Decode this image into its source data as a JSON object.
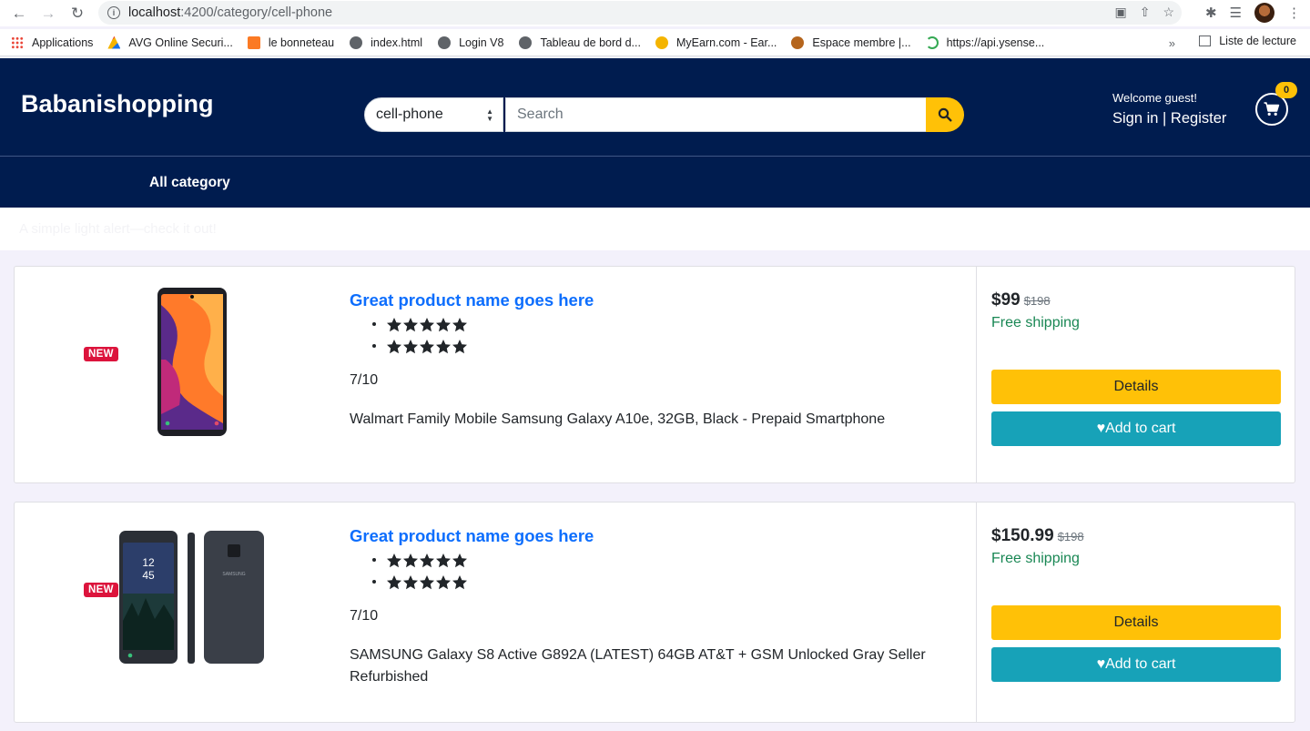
{
  "browser": {
    "url_host": "localhost",
    "url_path": ":4200/category/cell-phone",
    "bookmarks": [
      {
        "label": "Applications",
        "icon": "apps-grid-icon"
      },
      {
        "label": "AVG Online Securi...",
        "icon": "avg-icon"
      },
      {
        "label": "le bonneteau",
        "icon": "xampp-icon"
      },
      {
        "label": "index.html",
        "icon": "globe-icon"
      },
      {
        "label": "Login V8",
        "icon": "globe-icon"
      },
      {
        "label": "Tableau de bord d...",
        "icon": "globe-icon"
      },
      {
        "label": "MyEarn.com - Ear...",
        "icon": "myearn-icon"
      },
      {
        "label": "Espace membre |...",
        "icon": "espace-icon"
      },
      {
        "label": "https://api.ysense...",
        "icon": "ysense-icon"
      }
    ],
    "more": "»",
    "reading_list": "Liste de lecture"
  },
  "header": {
    "brand": "Babanishopping",
    "category_selected": "cell-phone",
    "search_placeholder": "Search",
    "welcome": "Welcome guest!",
    "sign_in": "Sign in",
    "separator": " | ",
    "register": "Register",
    "cart_count": "0"
  },
  "nav": {
    "all_category": "All category"
  },
  "alert": {
    "text": "A simple light alert—check it out!"
  },
  "products": [
    {
      "badge": "NEW",
      "title": "Great product name goes here",
      "rating_rows": 2,
      "stars_per_row": 5,
      "rating_score": "7/10",
      "description": "Walmart Family Mobile Samsung Galaxy A10e, 32GB, Black - Prepaid Smartphone",
      "price": "$99",
      "old_price": "$198",
      "shipping": "Free shipping",
      "details_label": "Details",
      "cart_label": "Add to cart"
    },
    {
      "badge": "NEW",
      "title": "Great product name goes here",
      "rating_rows": 2,
      "stars_per_row": 5,
      "rating_score": "7/10",
      "description": "SAMSUNG Galaxy S8 Active G892A (LATEST) 64GB AT&T + GSM Unlocked Gray Seller Refurbished",
      "price": "$150.99",
      "old_price": "$198",
      "shipping": "Free shipping",
      "details_label": "Details",
      "cart_label": "Add to cart"
    }
  ],
  "colors": {
    "header_bg": "#001c4f",
    "accent_yellow": "#ffc107",
    "cart_teal": "#17a2b8",
    "title_blue": "#0d6efd",
    "shipping_green": "#198754",
    "badge_red": "#dc143c"
  }
}
